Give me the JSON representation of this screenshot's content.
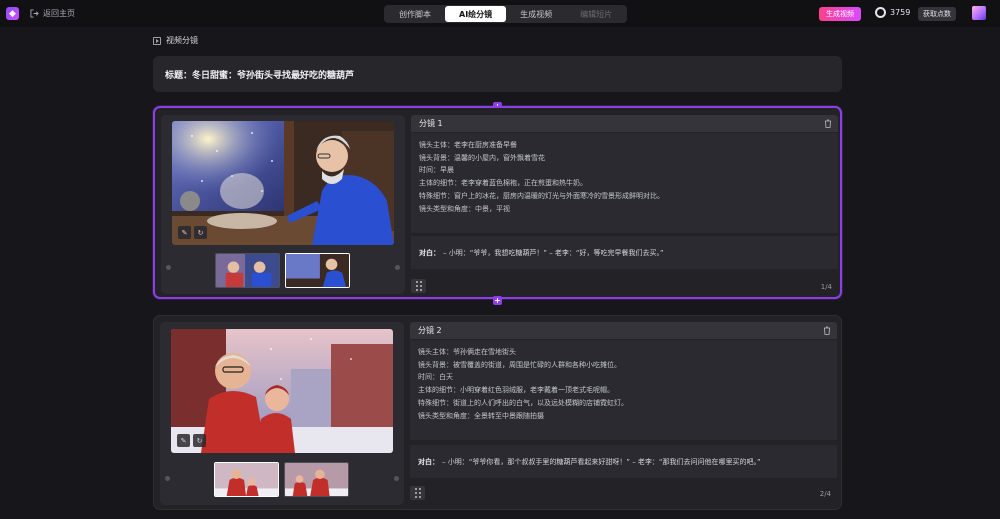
{
  "topbar": {
    "back_label": "返回主页",
    "tabs": [
      {
        "label": "创作脚本",
        "state": "normal"
      },
      {
        "label": "AI绘分镜",
        "state": "active"
      },
      {
        "label": "生成视频",
        "state": "normal"
      },
      {
        "label": "编辑短片",
        "state": "disabled"
      }
    ],
    "generate_label": "生成视频",
    "credits": "3759",
    "get_points_label": "获取点数"
  },
  "section_title": "视频分镜",
  "title_line": "标题：冬日甜蜜：爷孙街头寻找最好吃的糖葫芦",
  "shots": [
    {
      "header": "分镜 1",
      "lines": [
        "镜头主体：老李在厨房准备早餐",
        "镜头背景：温馨的小屋内，窗外飘着雪花",
        "时间：早晨",
        "主体的细节：老李穿着蓝色棉袍，正在煎蛋和热牛奶。",
        "特殊细节：窗户上的冰花，厨房内温暖的灯光与外面寒冷的雪景形成鲜明对比。",
        "镜头类型和角度：中景，平视"
      ],
      "dialog_label": "对白：",
      "dialog_text": "– 小明：“爷爷，我想吃糖葫芦！” – 老李：“好，等吃完早餐我们去买。”",
      "pager": "1/4"
    },
    {
      "header": "分镜 2",
      "lines": [
        "镜头主体：爷孙俩走在雪地街头",
        "镜头背景：被雪覆盖的街道，周围是忙碌的人群和各种小吃摊位。",
        "时间：白天",
        "主体的细节：小明穿着红色羽绒服，老李戴着一顶老式毛呢帽。",
        "特殊细节：街道上的人们呼出的白气，以及远处模糊的店铺霓虹灯。",
        "镜头类型和角度：全景转至中景跟随拍摄"
      ],
      "dialog_label": "对白：",
      "dialog_text": "– 小明：“爷爷你看，那个叔叔手里的糖葫芦看起来好甜呀！” – 老李：“那我们去问问他在哪里买的吧。”",
      "pager": "2/4"
    }
  ],
  "colors": {
    "accent": "#8c3fe6",
    "generate_gradient_start": "#ff3f8a",
    "generate_gradient_end": "#d94bff"
  }
}
